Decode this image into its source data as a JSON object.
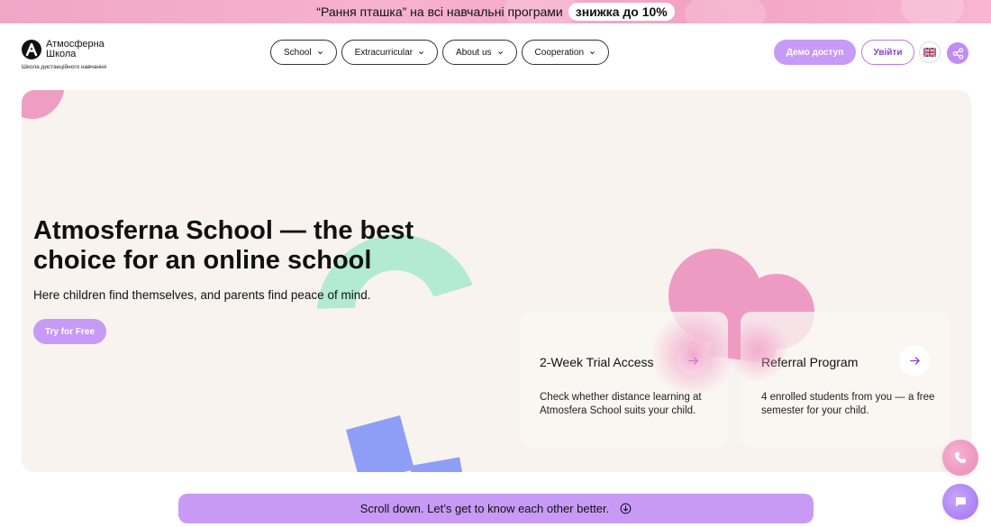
{
  "promo": {
    "text": "“Рання пташка” на всі навчальні програми",
    "highlight": "знижка до 10%"
  },
  "header": {
    "logo": {
      "name": "Атмосферна Школа",
      "tagline": "Школа дистанційного навчання",
      "icon": "logo-a-icon"
    },
    "nav": [
      {
        "label": "School"
      },
      {
        "label": "Extracurricular"
      },
      {
        "label": "About us"
      },
      {
        "label": "Cooperation"
      }
    ],
    "demo_label": "Демо доступ",
    "login_label": "Увійти",
    "language_icon": "uk-flag-icon",
    "share_icon": "share-icon"
  },
  "hero": {
    "title": "Atmosferna School — the best choice for an online school",
    "subtitle": "Here children find themselves, and parents find peace of mind.",
    "cta_label": "Try for Free",
    "cards": [
      {
        "title": "2-Week Trial Access",
        "description": "Check whether distance learning at Atmosfera School suits your child."
      },
      {
        "title": "Referral Program",
        "description": "4 enrolled students from you — a free semester for your child."
      }
    ]
  },
  "scroll_prompt": "Scroll down. Let’s get to know each other better.",
  "colors": {
    "accent_purple": "#c79af7",
    "accent_pink": "#ef9ec3",
    "accent_green": "#b2ead2",
    "accent_blue": "#8e9ef7",
    "hero_bg": "#f8f3ee"
  },
  "floating": {
    "phone_icon": "phone-icon",
    "chat_icon": "chat-icon"
  }
}
